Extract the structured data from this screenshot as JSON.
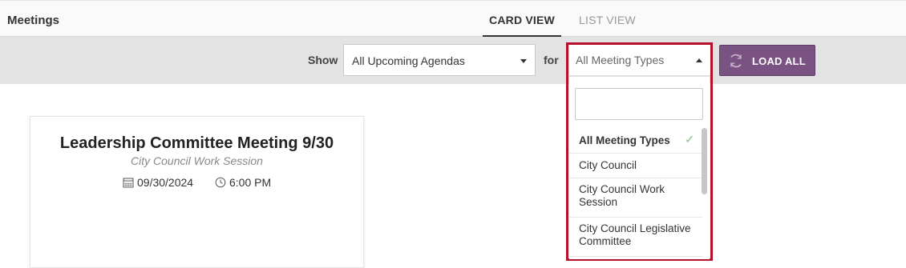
{
  "header": {
    "title": "Meetings"
  },
  "tabs": [
    {
      "label": "CARD VIEW",
      "active": true
    },
    {
      "label": "LIST VIEW",
      "active": false
    }
  ],
  "filters": {
    "show_label": "Show",
    "show_value": "All Upcoming Agendas",
    "for_label": "for",
    "type_value": "All Meeting Types",
    "search_value": "",
    "load_all_label": "LOAD ALL"
  },
  "dropdown": {
    "items": [
      {
        "label": "All Meeting Types",
        "selected": true
      },
      {
        "label": "City Council",
        "selected": false
      },
      {
        "label": "City Council Work Session",
        "selected": false
      },
      {
        "label": "City Council Legislative Committee",
        "selected": false
      }
    ]
  },
  "meeting_card": {
    "title": "Leadership Committee Meeting 9/30",
    "subtitle": "City Council Work Session",
    "date": "09/30/2024",
    "time": "6:00 PM"
  },
  "colors": {
    "accent_purple": "#7b5383",
    "highlight_red": "#b80f2c",
    "check_green": "#9bd19b",
    "filter_bar": "#e3e3e3"
  },
  "icons": [
    "calendar-icon",
    "clock-icon",
    "refresh-icon",
    "check-icon",
    "caret-down-icon",
    "caret-up-icon"
  ]
}
